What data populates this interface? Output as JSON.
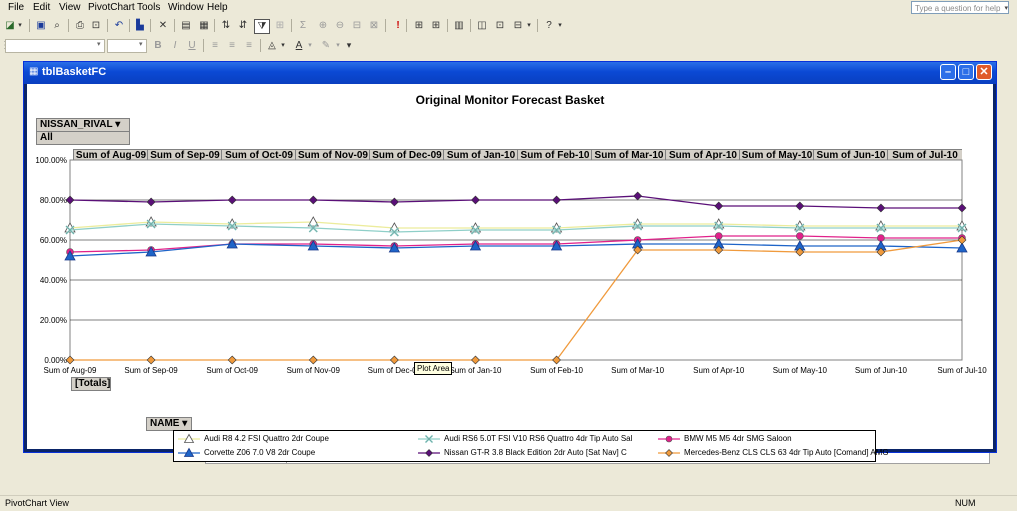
{
  "menubar": {
    "items": [
      "File",
      "Edit",
      "View",
      "PivotChart",
      "Tools",
      "Window",
      "Help"
    ],
    "help_placeholder": "Type a question for help"
  },
  "window": {
    "title": "tblBasketFC"
  },
  "pivot": {
    "filter_field": "NISSAN_RIVAL",
    "filter_value": "All",
    "category_field": "[Totals]",
    "series_field": "NAME"
  },
  "tooltip": "Plot Area",
  "status": {
    "left": "PivotChart View",
    "right": "NUM"
  },
  "chart_data": {
    "type": "line",
    "title": "Original Monitor Forecast Basket",
    "column_headers": [
      "Sum of Aug-09",
      "Sum of Sep-09",
      "Sum of Oct-09",
      "Sum of Nov-09",
      "Sum of Dec-09",
      "Sum of Jan-10",
      "Sum of Feb-10",
      "Sum of Mar-10",
      "Sum of Apr-10",
      "Sum of May-10",
      "Sum of Jun-10",
      "Sum of Jul-10"
    ],
    "categories": [
      "Sum of Aug-09",
      "Sum of Sep-09",
      "Sum of Oct-09",
      "Sum of Nov-09",
      "Sum of Dec-09",
      "Sum of Jan-10",
      "Sum of Feb-10",
      "Sum of Mar-10",
      "Sum of Apr-10",
      "Sum of May-10",
      "Sum of Jun-10",
      "Sum of Jul-10"
    ],
    "y_ticks": [
      "0.00%",
      "20.00%",
      "40.00%",
      "60.00%",
      "80.00%",
      "100.00%"
    ],
    "ylim": [
      0,
      100
    ],
    "grid": true,
    "legend_position": "bottom",
    "series": [
      {
        "name": "Audi R8 4.2 FSI Quattro 2dr Coupe",
        "color": "#ecec9c",
        "marker": "triangle-open",
        "values": [
          66,
          69,
          68,
          69,
          66,
          66,
          66,
          68,
          68,
          67,
          67,
          67
        ]
      },
      {
        "name": "Audi RS6 5.0T FSI V10 RS6 Quattro 4dr Tip Auto Sal",
        "color": "#8fcfc8",
        "marker": "x",
        "values": [
          65,
          68,
          67,
          66,
          64,
          65,
          65,
          67,
          67,
          66,
          66,
          66
        ]
      },
      {
        "name": "BMW M5 M5 4dr SMG Saloon",
        "color": "#e0218a",
        "marker": "circle",
        "values": [
          54,
          55,
          58,
          58,
          57,
          58,
          58,
          60,
          62,
          62,
          61,
          61
        ]
      },
      {
        "name": "Corvette Z06 7.0 V8 2dr Coupe",
        "color": "#1e64c8",
        "marker": "triangle",
        "values": [
          52,
          54,
          58,
          57,
          56,
          57,
          57,
          58,
          58,
          57,
          57,
          56
        ]
      },
      {
        "name": "Nissan GT-R 3.8 Black Edition 2dr Auto [Sat Nav] C",
        "color": "#5a0f78",
        "marker": "diamond",
        "values": [
          80,
          79,
          80,
          80,
          79,
          80,
          80,
          82,
          77,
          77,
          76,
          76
        ]
      },
      {
        "name": "Mercedes-Benz CLS CLS 63 4dr Tip Auto [Comand] AMG",
        "color": "#f09a3c",
        "marker": "diamond",
        "values": [
          0,
          0,
          0,
          0,
          0,
          0,
          0,
          55,
          55,
          54,
          54,
          60
        ]
      }
    ]
  }
}
